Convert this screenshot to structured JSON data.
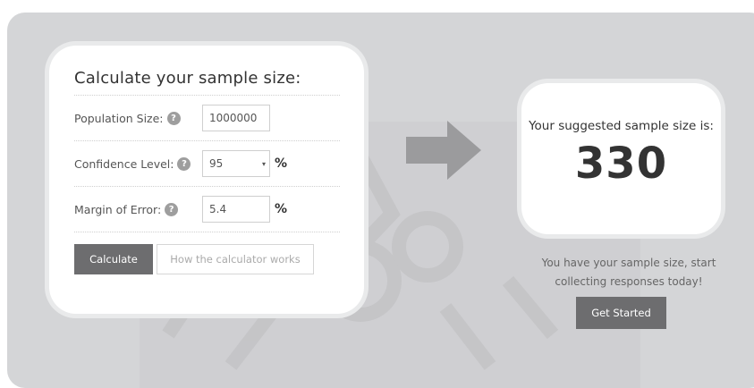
{
  "calculator": {
    "title": "Calculate your sample size:",
    "population": {
      "label": "Population Size:",
      "value": "1000000"
    },
    "confidence": {
      "label": "Confidence Level:",
      "value": "95",
      "unit": "%"
    },
    "margin": {
      "label": "Margin of Error:",
      "value": "5.4",
      "unit": "%"
    },
    "help_glyph": "?",
    "calculate_label": "Calculate",
    "how_label": "How the calculator works"
  },
  "result": {
    "label": "Your suggested sample size is:",
    "value": "330",
    "cta_text": "You have your sample size, start collecting responses today!",
    "get_started_label": "Get Started"
  },
  "colors": {
    "background": "#d4d5d7",
    "card": "#ffffff",
    "button": "#6d6d6f",
    "arrow": "#9b9b9d"
  }
}
